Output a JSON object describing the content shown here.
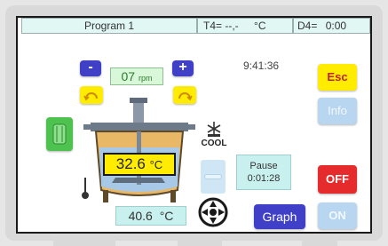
{
  "header": {
    "program_label": "Program 1",
    "t4_label": "T4=",
    "t4_value": "--,-",
    "t4_unit": "°C",
    "d4_label": "D4=",
    "d4_value": "0:00"
  },
  "speed": {
    "minus_label": "-",
    "plus_label": "+",
    "value": "07",
    "unit": "rpm"
  },
  "clock": "9:41:36",
  "buttons": {
    "esc": "Esc",
    "info": "Info",
    "off": "OFF",
    "on": "ON",
    "graph": "Graph"
  },
  "temperature": {
    "vessel_value": "32.6",
    "vessel_unit": "°C",
    "probe_value": "40.6",
    "probe_unit": "°C"
  },
  "cool_label": "COOL",
  "pause": {
    "label": "Pause",
    "time": "0:01:28"
  },
  "colors": {
    "header_bg": "#e0f7f4",
    "blue_button": "#3f3fc7",
    "yellow_button": "#ffec00",
    "off_button": "#e52b2b",
    "disabled_button": "#b8d6f0",
    "speed_field": "#d9f7d9"
  },
  "icons": {
    "rotate_left": "rotate-left-icon",
    "rotate_right": "rotate-right-icon",
    "container": "container-icon",
    "cool": "snowflake-fan-icon",
    "probe": "temperature-probe-icon",
    "steering": "steering-wheel-icon"
  }
}
